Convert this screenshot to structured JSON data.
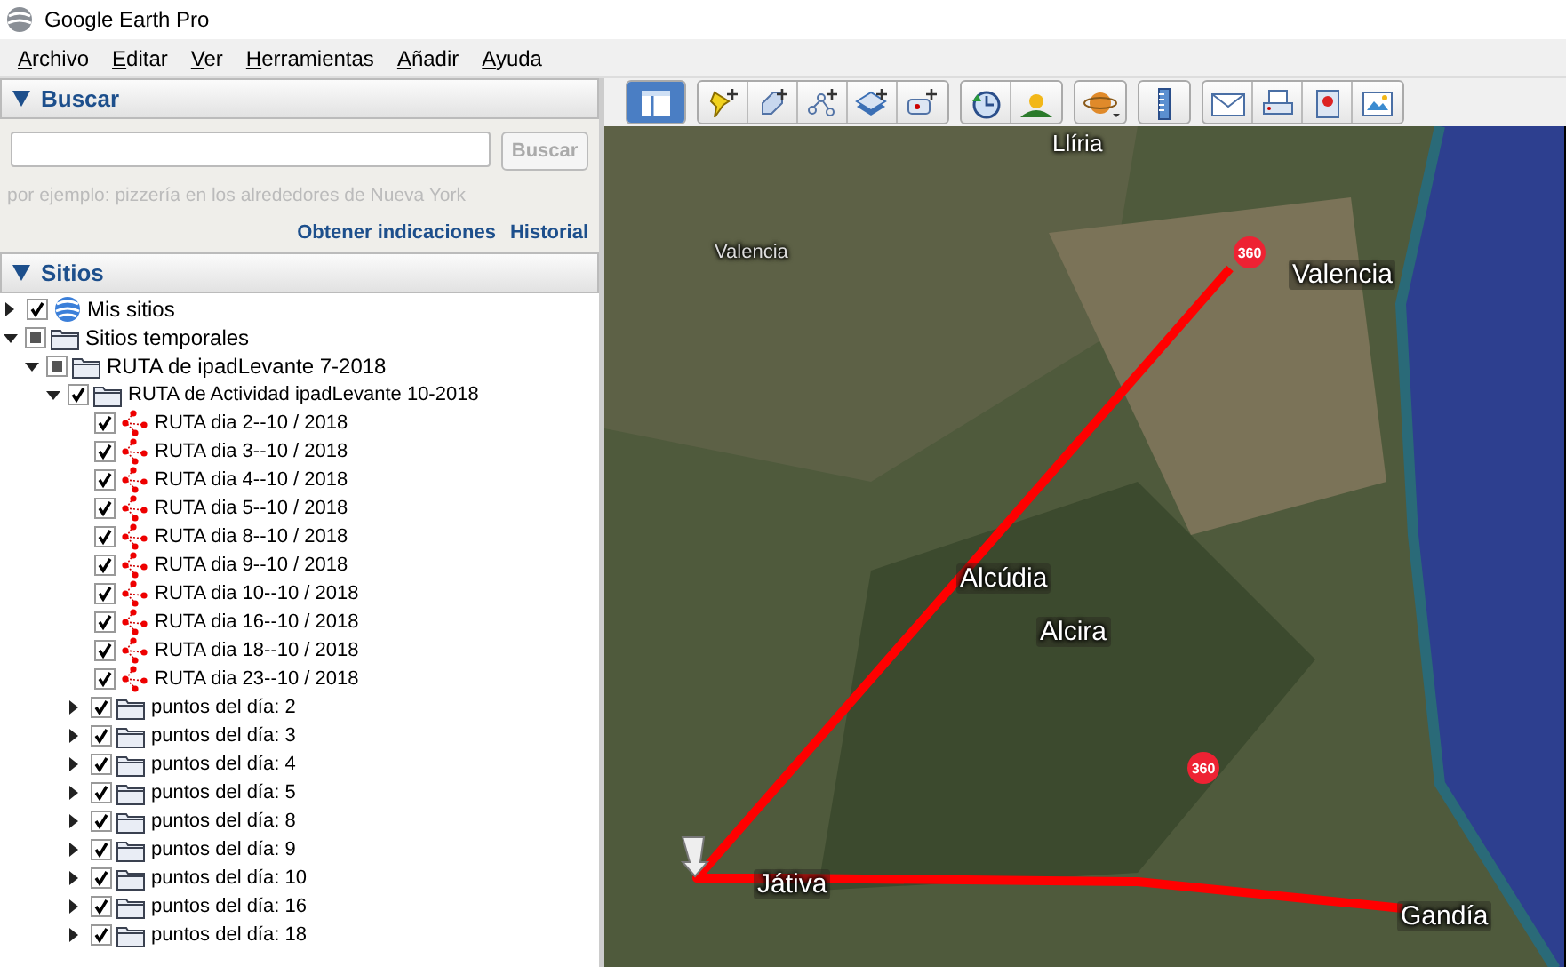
{
  "window": {
    "title": "Google Earth Pro"
  },
  "menu": [
    "Archivo",
    "Editar",
    "Ver",
    "Herramientas",
    "Añadir",
    "Ayuda"
  ],
  "search_panel": {
    "title": "Buscar",
    "expanded": true,
    "button": {
      "label": "Buscar",
      "disabled": true
    },
    "hint": "por ejemplo: pizzería en los alrededores de Nueva York",
    "links": [
      "Obtener indicaciones",
      "Historial"
    ]
  },
  "places_panel": {
    "title": "Sitios",
    "expanded": true,
    "items": [
      {
        "kind": "globe",
        "label": "Mis sitios",
        "checked": true,
        "mixed": false,
        "expanded": false
      },
      {
        "kind": "folder",
        "label": "Sitios temporales",
        "checked": true,
        "mixed": true,
        "expanded": true,
        "children": [
          {
            "kind": "folder",
            "label": "RUTA de ipadLevante  7-2018",
            "checked": true,
            "mixed": true,
            "expanded": true,
            "children": [
              {
                "kind": "folder",
                "label": "RUTA de Actividad ipadLevante 10-2018",
                "checked": true,
                "mixed": false,
                "expanded": true,
                "children": [
                  {
                    "kind": "route",
                    "label": "RUTA dia 2--10 / 2018",
                    "checked": true,
                    "mixed": false
                  },
                  {
                    "kind": "route",
                    "label": "RUTA dia 3--10 / 2018",
                    "checked": true,
                    "mixed": false
                  },
                  {
                    "kind": "route",
                    "label": "RUTA dia 4--10 / 2018",
                    "checked": true,
                    "mixed": false
                  },
                  {
                    "kind": "route",
                    "label": "RUTA dia 5--10 / 2018",
                    "checked": true,
                    "mixed": false
                  },
                  {
                    "kind": "route",
                    "label": "RUTA dia 8--10 / 2018",
                    "checked": true,
                    "mixed": false
                  },
                  {
                    "kind": "route",
                    "label": "RUTA dia 9--10 / 2018",
                    "checked": true,
                    "mixed": false
                  },
                  {
                    "kind": "route",
                    "label": "RUTA dia 10--10 / 2018",
                    "checked": true,
                    "mixed": false
                  },
                  {
                    "kind": "route",
                    "label": "RUTA dia 16--10 / 2018",
                    "checked": true,
                    "mixed": false
                  },
                  {
                    "kind": "route",
                    "label": "RUTA dia 18--10 / 2018",
                    "checked": true,
                    "mixed": false
                  },
                  {
                    "kind": "route",
                    "label": "RUTA dia 23--10 / 2018",
                    "checked": true,
                    "mixed": false
                  },
                  {
                    "kind": "folder",
                    "label": "puntos del día: 2",
                    "checked": true,
                    "mixed": false,
                    "expanded": false
                  },
                  {
                    "kind": "folder",
                    "label": "puntos del día: 3",
                    "checked": true,
                    "mixed": false,
                    "expanded": false
                  },
                  {
                    "kind": "folder",
                    "label": "puntos del día: 4",
                    "checked": true,
                    "mixed": false,
                    "expanded": false
                  },
                  {
                    "kind": "folder",
                    "label": "puntos del día: 5",
                    "checked": true,
                    "mixed": false,
                    "expanded": false
                  },
                  {
                    "kind": "folder",
                    "label": "puntos del día: 8",
                    "checked": true,
                    "mixed": false,
                    "expanded": false
                  },
                  {
                    "kind": "folder",
                    "label": "puntos del día: 9",
                    "checked": true,
                    "mixed": false,
                    "expanded": false
                  },
                  {
                    "kind": "folder",
                    "label": "puntos del día: 10",
                    "checked": true,
                    "mixed": false,
                    "expanded": false
                  },
                  {
                    "kind": "folder",
                    "label": "puntos del día: 16",
                    "checked": true,
                    "mixed": false,
                    "expanded": false
                  },
                  {
                    "kind": "folder",
                    "label": "puntos del día: 18",
                    "checked": true,
                    "mixed": false,
                    "expanded": false
                  }
                ]
              }
            ]
          }
        ]
      }
    ]
  },
  "toolbar": {
    "sidebar_button": {
      "selected": true
    }
  },
  "map": {
    "labels": [
      {
        "kind": "town",
        "text": "Llíria"
      },
      {
        "kind": "region",
        "text": "Valencia"
      },
      {
        "kind": "city",
        "text": "Valencia"
      },
      {
        "kind": "city",
        "text": "Alcúdia"
      },
      {
        "kind": "city",
        "text": "Alcira"
      },
      {
        "kind": "city",
        "text": "Játiva"
      },
      {
        "kind": "city",
        "text": "Gandía"
      }
    ],
    "badges": [
      "360",
      "360"
    ]
  }
}
